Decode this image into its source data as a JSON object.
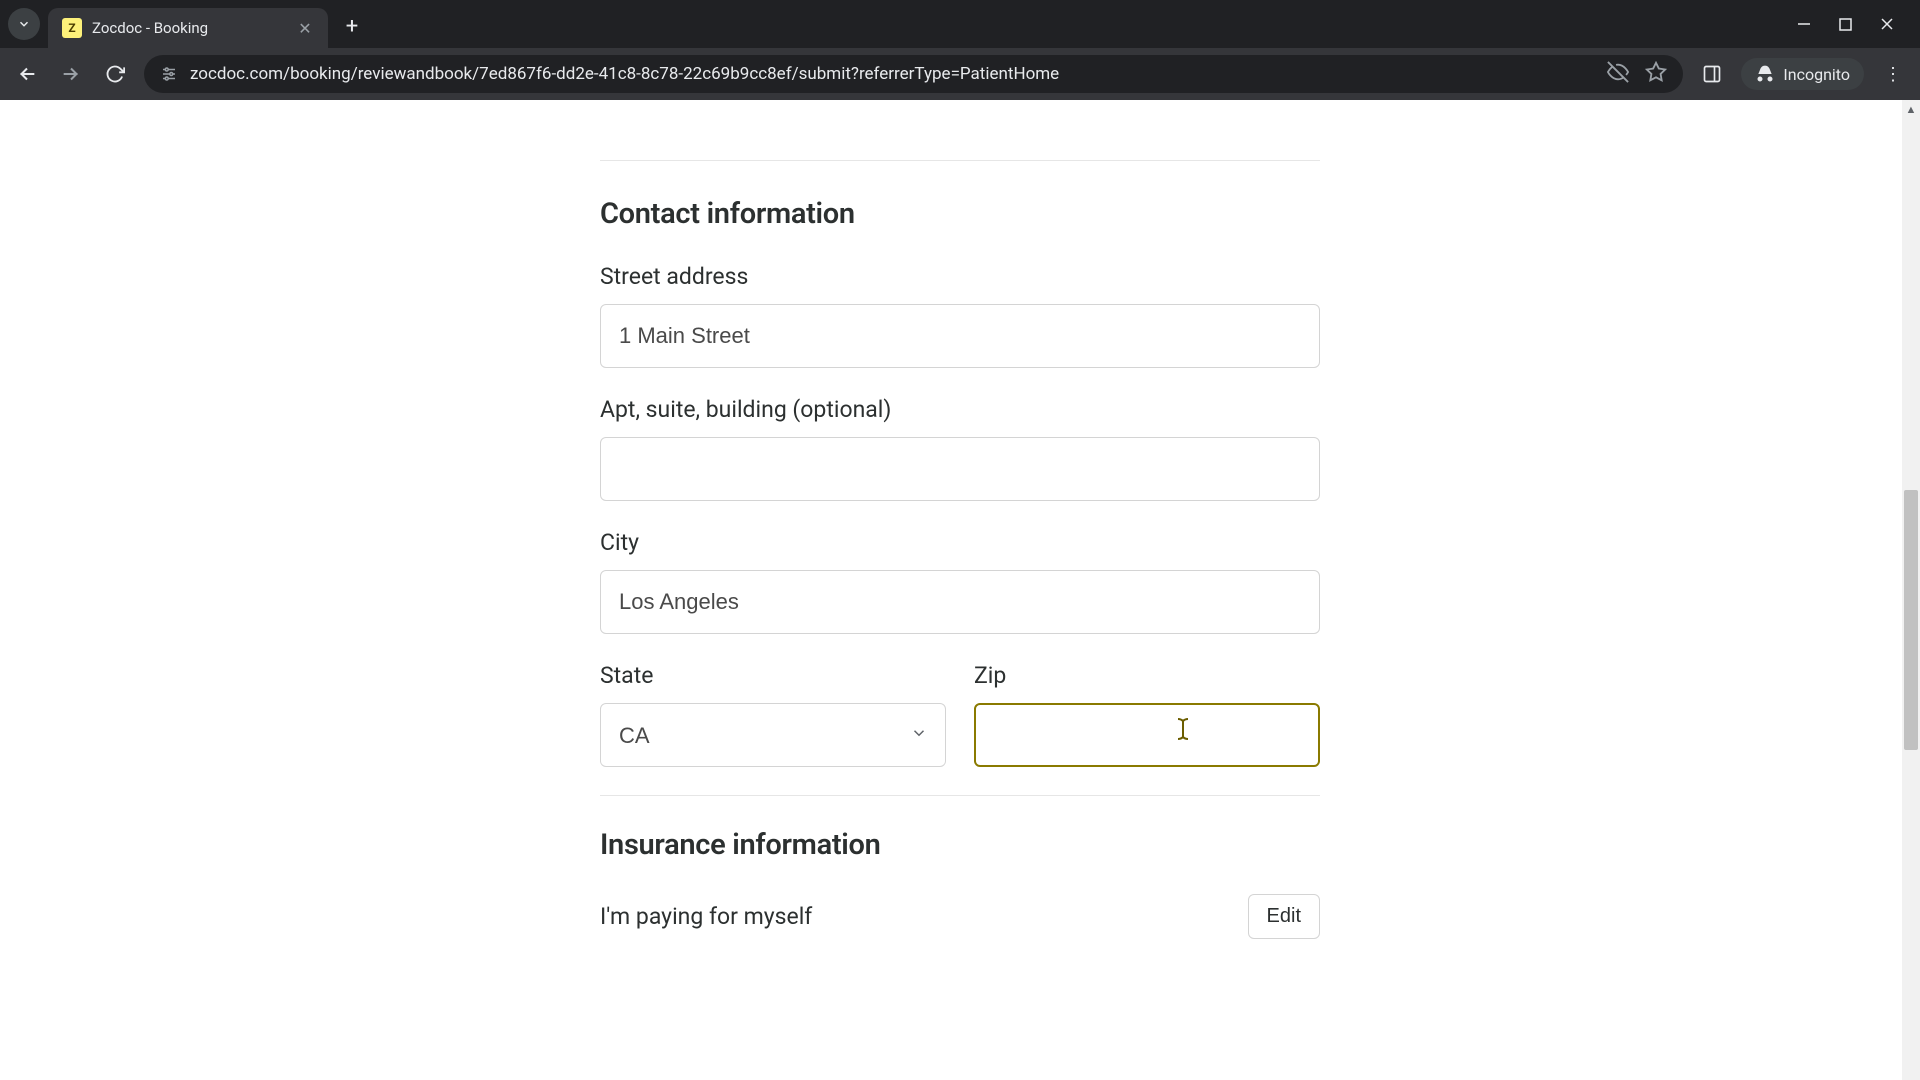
{
  "browser": {
    "tab_title": "Zocdoc - Booking",
    "url": "zocdoc.com/booking/reviewandbook/7ed867f6-dd2e-41c8-8c78-22c69b9cc8ef/submit?referrerType=PatientHome",
    "incognito_label": "Incognito",
    "favicon_letter": "Z"
  },
  "form": {
    "contact_heading": "Contact information",
    "street_label": "Street address",
    "street_value": "1 Main Street",
    "apt_label": "Apt, suite, building (optional)",
    "apt_value": "",
    "city_label": "City",
    "city_value": "Los Angeles",
    "state_label": "State",
    "state_value": "CA",
    "zip_label": "Zip",
    "zip_value": "",
    "insurance_heading": "Insurance information",
    "insurance_text": "I'm paying for myself",
    "edit_label": "Edit"
  }
}
